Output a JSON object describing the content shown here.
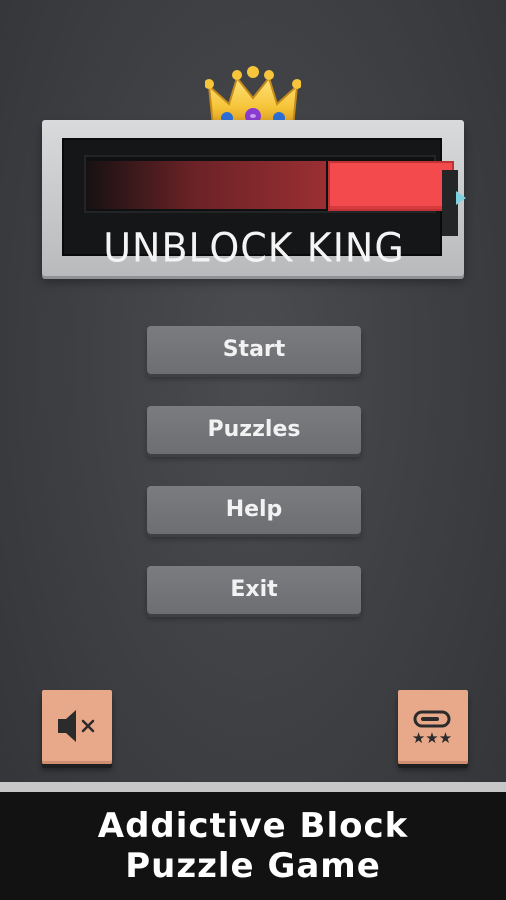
{
  "logo": {
    "title": "UNBLOCK KING",
    "colors": {
      "block": "#f24a4d",
      "board": "#c9cbcd",
      "slot": "#151617",
      "exit_arrow": "#7fd2e0"
    }
  },
  "menu": {
    "items": [
      {
        "label": "Start"
      },
      {
        "label": "Puzzles"
      },
      {
        "label": "Help"
      },
      {
        "label": "Exit"
      }
    ]
  },
  "controls": {
    "sound_icon": "speaker-muted-icon",
    "rate_icon": "rate-stars-icon",
    "button_color": "#e8a98a"
  },
  "banner": {
    "line1": "Addictive Block",
    "line2": "Puzzle Game"
  },
  "icons": [
    "crown-icon",
    "speaker-muted-icon",
    "rate-stars-icon",
    "exit-arrow-icon"
  ]
}
